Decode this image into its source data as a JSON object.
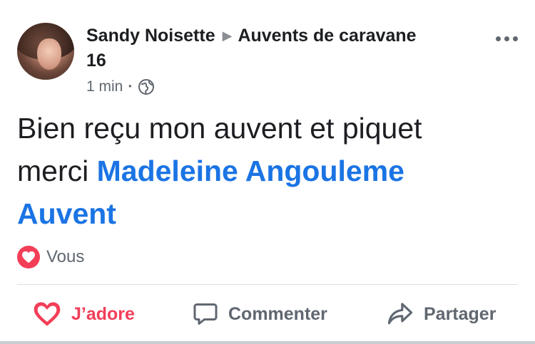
{
  "post": {
    "author": "Sandy Noisette",
    "group": "Auvents de caravane 16",
    "group_line1": "Auvents de caravane",
    "group_line2": "16",
    "time": "1 min",
    "time_separator": "·",
    "privacy_icon": "globe-icon",
    "text": "Bien reçu mon auvent et piquet merci",
    "text_line1": "Bien reçu mon auvent et piquet",
    "text_line2": "merci",
    "mention": "Madeleine Angouleme Auvent",
    "mention_line1": "Madeleine Angouleme",
    "mention_line2": "Auvent"
  },
  "reactions": {
    "icon": "heart-icon",
    "summary": "Vous"
  },
  "actions": {
    "like": {
      "label": "J’adore",
      "icon": "heart-icon"
    },
    "comment": {
      "label": "Commenter",
      "icon": "comment-icon"
    },
    "share": {
      "label": "Partager",
      "icon": "share-icon"
    }
  },
  "colors": {
    "mention": "#1b74e4",
    "love": "#f33e58",
    "secondary_text": "#606770",
    "divider": "#dadde1"
  }
}
